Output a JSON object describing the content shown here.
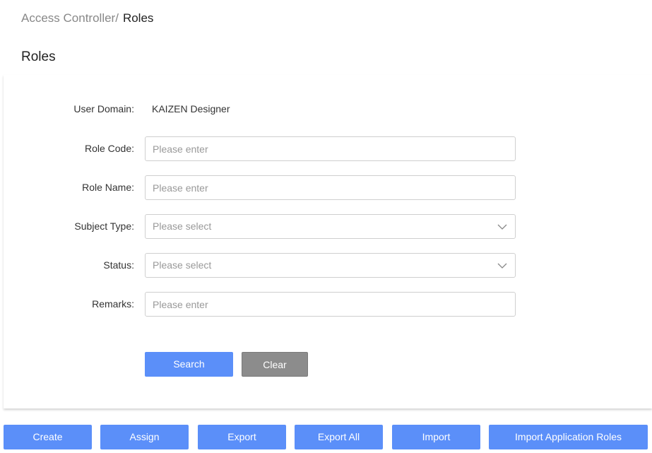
{
  "breadcrumb": {
    "parent": "Access Controller/",
    "current": "Roles"
  },
  "page_title": "Roles",
  "form": {
    "user_domain": {
      "label": "User Domain:",
      "value": "KAIZEN Designer"
    },
    "role_code": {
      "label": "Role Code:",
      "placeholder": "Please enter"
    },
    "role_name": {
      "label": "Role Name:",
      "placeholder": "Please enter"
    },
    "subject_type": {
      "label": "Subject Type:",
      "placeholder": "Please select"
    },
    "status": {
      "label": "Status:",
      "placeholder": "Please select"
    },
    "remarks": {
      "label": "Remarks:",
      "placeholder": "Please enter"
    },
    "search_label": "Search",
    "clear_label": "Clear"
  },
  "actions": {
    "create": "Create",
    "assign": "Assign",
    "export": "Export",
    "export_all": "Export All",
    "import": "Import",
    "import_app_roles": "Import Application Roles"
  },
  "colors": {
    "primary": "#5b8ff9",
    "secondary": "#8c8c8c"
  }
}
